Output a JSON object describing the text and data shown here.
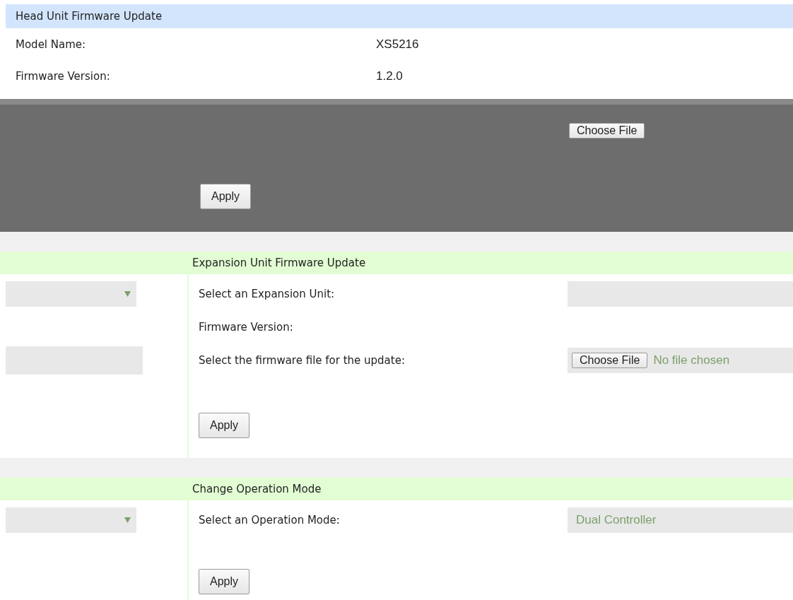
{
  "head_unit": {
    "title": "Head Unit Firmware Update",
    "rows": [
      {
        "label": "Model Name:",
        "value": "XS5216"
      },
      {
        "label": "Firmware Version:",
        "value": "1.2.0"
      }
    ],
    "file_button": "Choose File",
    "apply": "Apply"
  },
  "sections": [
    {
      "title": "Expansion Unit Firmware Update",
      "rows": [
        {
          "kind": "select",
          "label": "Select an Expansion Unit:"
        },
        {
          "kind": "text",
          "label": "Firmware Version:"
        },
        {
          "kind": "file",
          "label": "Select the firmware file for the update:",
          "button": "Choose File",
          "status": "No file chosen"
        }
      ],
      "apply": "Apply"
    },
    {
      "title": "Change Operation Mode",
      "rows": [
        {
          "kind": "select",
          "label": "Select an Operation Mode:",
          "value": "Dual Controller"
        }
      ],
      "apply": "Apply"
    }
  ]
}
